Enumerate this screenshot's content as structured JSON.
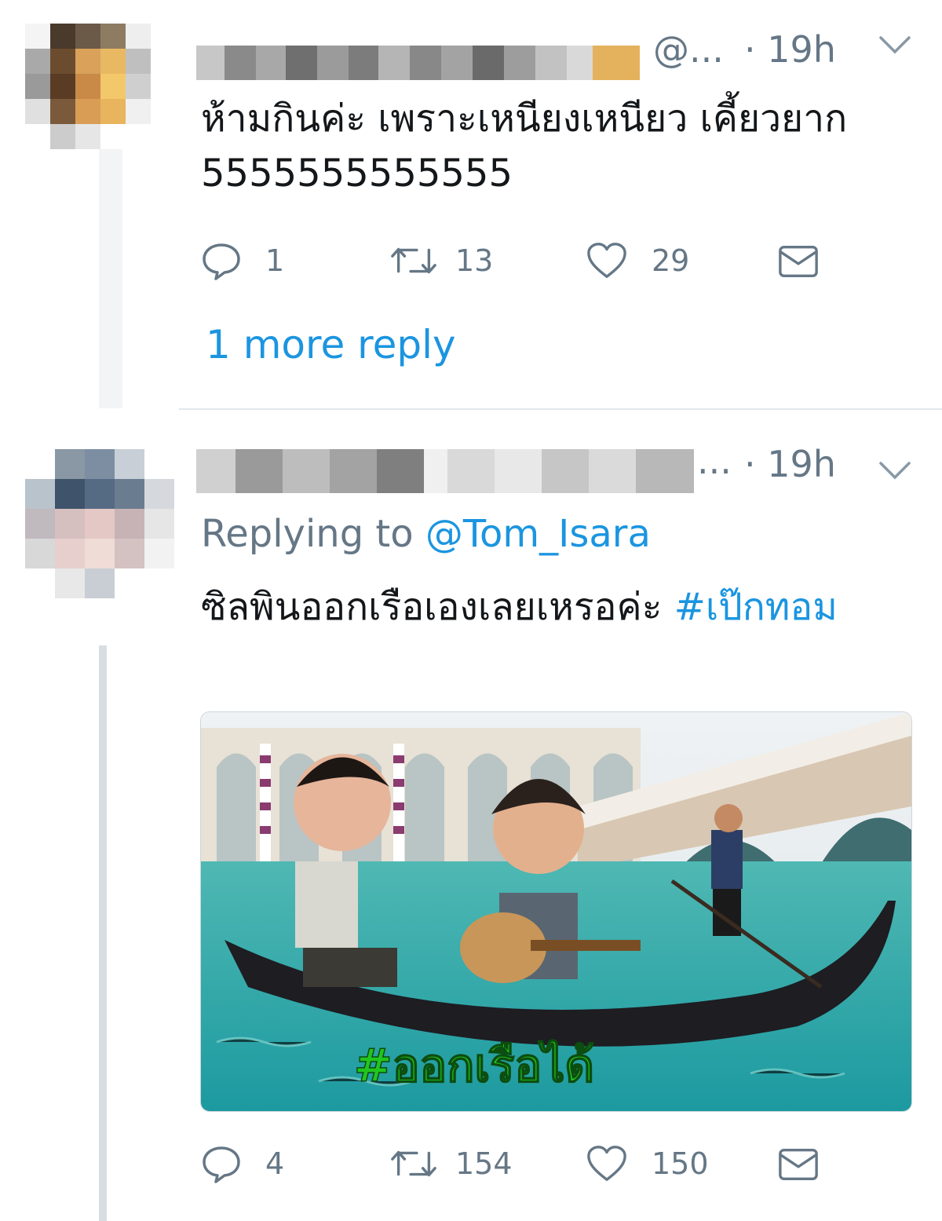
{
  "tweets": [
    {
      "handle": "@...",
      "time": "· 19h",
      "text": "ห้ามกินค่ะ เพราะเหนียงเหนียว เคี้ยวยาก 5555555555555",
      "actions": {
        "replies": "1",
        "retweets": "13",
        "likes": "29"
      },
      "more_replies": "1 more reply"
    },
    {
      "handle": "...",
      "time": "· 19h",
      "replying_prefix": "Replying to",
      "replying_handle": "@Tom_Isara",
      "text": "ซิลพินออกเรือเองเลยเหรอค่ะ",
      "hashtag": "#เป๊กทอม",
      "media": {
        "overlay_text": "#ออกเรือได้"
      },
      "actions": {
        "replies": "4",
        "retweets": "154",
        "likes": "150"
      }
    }
  ],
  "icons": {
    "reply": "speech-bubble-icon",
    "retweet": "retweet-icon",
    "like": "heart-icon",
    "dm": "envelope-icon",
    "menu": "chevron-down-icon"
  },
  "colors": {
    "link": "#1b95e0",
    "secondary": "#657786",
    "overlay_text": "#22c51e"
  }
}
